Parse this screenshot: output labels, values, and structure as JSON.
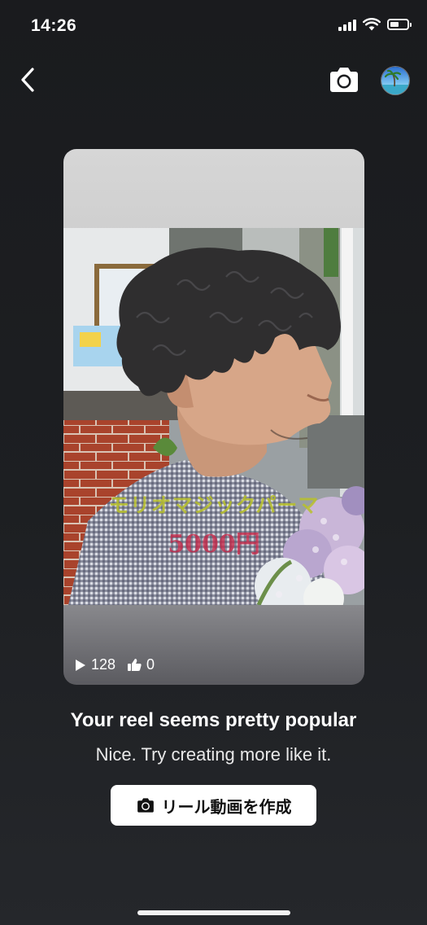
{
  "status_bar": {
    "time": "14:26",
    "icons": [
      "signal-icon",
      "wifi-icon",
      "battery-icon"
    ]
  },
  "nav": {
    "back_icon": "chevron-left-icon",
    "camera_icon": "camera-icon",
    "avatar": "profile-avatar"
  },
  "reel": {
    "overlay_title": "モリオマジックパーマ",
    "overlay_price": "5000円",
    "plays": "128",
    "likes": "0",
    "play_icon": "play-icon",
    "like_icon": "thumbs-up-icon"
  },
  "message": {
    "headline": "Your reel seems pretty popular",
    "subtext": "Nice. Try creating more like it."
  },
  "cta": {
    "label": "リール動画を作成",
    "icon": "camera-icon"
  },
  "colors": {
    "background": "#1c1d20",
    "button_bg": "#ffffff",
    "overlay_title": "#b9c12a",
    "overlay_price": "#c62a4a"
  }
}
